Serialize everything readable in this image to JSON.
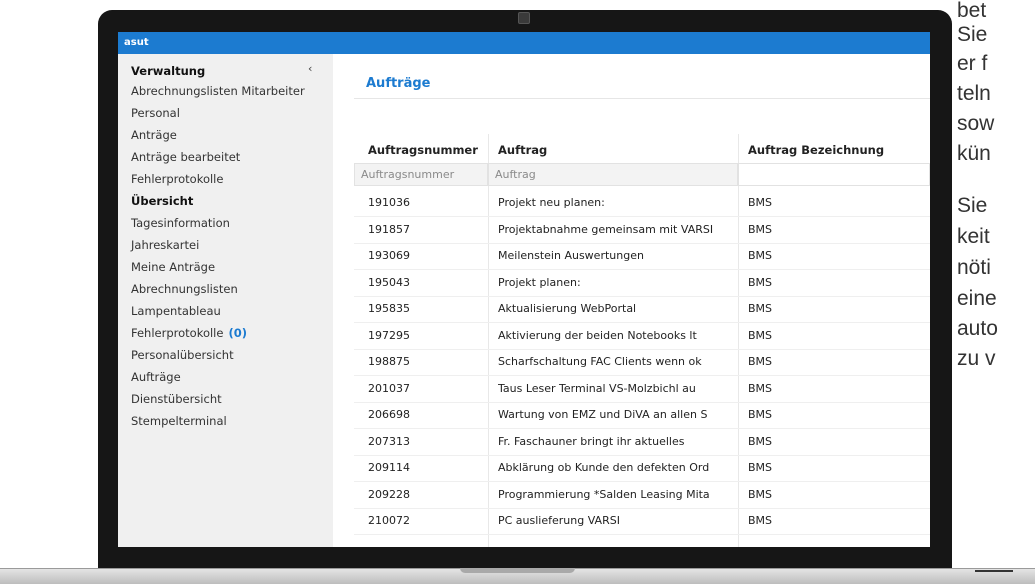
{
  "app": {
    "title": "asut"
  },
  "sidebar": {
    "collapse_icon": "‹",
    "items": [
      {
        "label": "Verwaltung",
        "bold": true
      },
      {
        "label": "Abrechnungslisten Mitarbeiter"
      },
      {
        "label": "Personal"
      },
      {
        "label": "Anträge"
      },
      {
        "label": "Anträge bearbeitet"
      },
      {
        "label": "Fehlerprotokolle"
      },
      {
        "label": "Übersicht",
        "bold": true
      },
      {
        "label": "Tagesinformation"
      },
      {
        "label": "Jahreskartei"
      },
      {
        "label": "Meine Anträge"
      },
      {
        "label": "Abrechnungslisten"
      },
      {
        "label": "Lampentableau"
      },
      {
        "label": "Fehlerprotokolle",
        "count": "(0)"
      },
      {
        "label": "Personalübersicht"
      },
      {
        "label": "Aufträge"
      },
      {
        "label": "Dienstübersicht"
      },
      {
        "label": "Stempelterminal"
      }
    ]
  },
  "main": {
    "title": "Aufträge",
    "columns": [
      "Auftragsnummer",
      "Auftrag",
      "Auftrag Bezeichnung"
    ],
    "filters": {
      "auftragsnummer_placeholder": "Auftragsnummer",
      "auftrag_placeholder": "Auftrag"
    },
    "rows": [
      [
        "191036",
        "Projekt neu planen:",
        "BMS"
      ],
      [
        "191857",
        "Projektabnahme gemeinsam mit VARSI",
        "BMS"
      ],
      [
        "193069",
        "Meilenstein Auswertungen",
        "BMS"
      ],
      [
        "195043",
        "Projekt planen:",
        "BMS"
      ],
      [
        "195835",
        "Aktualisierung WebPortal",
        "BMS"
      ],
      [
        "197295",
        "Aktivierung der beiden Notebooks lt",
        "BMS"
      ],
      [
        "198875",
        "Scharfschaltung FAC Clients wenn ok",
        "BMS"
      ],
      [
        "201037",
        "Taus Leser Terminal VS-Molzbichl au",
        "BMS"
      ],
      [
        "206698",
        "Wartung von EMZ und DiVA an allen S",
        "BMS"
      ],
      [
        "207313",
        "Fr. Faschauner bringt ihr aktuelles",
        "BMS"
      ],
      [
        "209114",
        "Abklärung ob Kunde den defekten Ord",
        "BMS"
      ],
      [
        "209228",
        "Programmierung *Salden Leasing Mita",
        "BMS"
      ],
      [
        "210072",
        "PC auslieferung VARSI",
        "BMS"
      ]
    ]
  },
  "side_text": {
    "lines": [
      "bet",
      "Sie",
      "er f",
      "teln",
      "sow",
      "kün",
      "Sie",
      "keit",
      "nöti",
      "eine",
      "auto",
      "zu v"
    ]
  }
}
